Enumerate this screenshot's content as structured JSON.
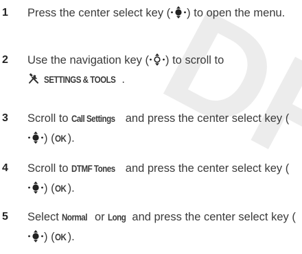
{
  "watermark": "DR",
  "steps": [
    {
      "num": "1",
      "text_a": "Press the center select key (",
      "text_b": ") to open the menu."
    },
    {
      "num": "2",
      "text_a": "Use the navigation key (",
      "text_b": ") to scroll to",
      "menu_label": "SETTINGS & TOOLS",
      "text_c": "."
    },
    {
      "num": "3",
      "text_a": "Scroll to ",
      "item": "Call Settings",
      "text_b": " and press the center select key (",
      "text_c": ") (",
      "ok": "OK",
      "text_d": ")."
    },
    {
      "num": "4",
      "text_a": "Scroll to ",
      "item": "DTMF Tones",
      "text_b": " and press the center select key (",
      "text_c": ") (",
      "ok": "OK",
      "text_d": ")."
    },
    {
      "num": "5",
      "text_a": "Select ",
      "opt1": "Normal",
      "text_or": " or ",
      "opt2": "Long",
      "text_b": " and press the center select key (",
      "text_c": ") (",
      "ok": "OK",
      "text_d": ")."
    }
  ],
  "icons": {
    "center_select": "center-select-key-icon",
    "navigation": "navigation-key-icon",
    "settings_tools": "settings-tools-icon"
  }
}
